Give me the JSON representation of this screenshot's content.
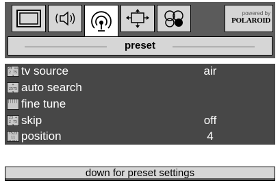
{
  "tabs": [
    {
      "icon": "screen-icon",
      "active": false
    },
    {
      "icon": "speaker-icon",
      "active": false
    },
    {
      "icon": "antenna-icon",
      "active": true
    },
    {
      "icon": "picture-adjust-icon",
      "active": false
    },
    {
      "icon": "features-icon",
      "active": false
    }
  ],
  "brand": {
    "powered": "powered by",
    "name": "POLAROID"
  },
  "header": {
    "title": "preset"
  },
  "menu": {
    "items": [
      {
        "label": "tv source",
        "value": "air",
        "icon": "tv-source-icon",
        "icon_text": "23 ++\n2 75 3"
      },
      {
        "label": "auto search",
        "value": "",
        "icon": "auto-search-icon",
        "icon_text": "+\n2575 3"
      },
      {
        "label": "fine tune",
        "value": "",
        "icon": "fine-tune-icon",
        "icon_text": "||||||"
      },
      {
        "label": "skip",
        "value": "off",
        "icon": "skip-icon",
        "icon_text": "23 +\n2 75 3"
      },
      {
        "label": "position",
        "value": "4",
        "icon": "position-icon",
        "icon_text": "T523 11\n2575123"
      }
    ]
  },
  "hint": {
    "text": "down for preset settings"
  },
  "colors": {
    "panel_dark": "#474747",
    "panel_mid": "#5b5b5b",
    "tab_face": "#d6d6d6",
    "text_light": "#ffffff"
  }
}
